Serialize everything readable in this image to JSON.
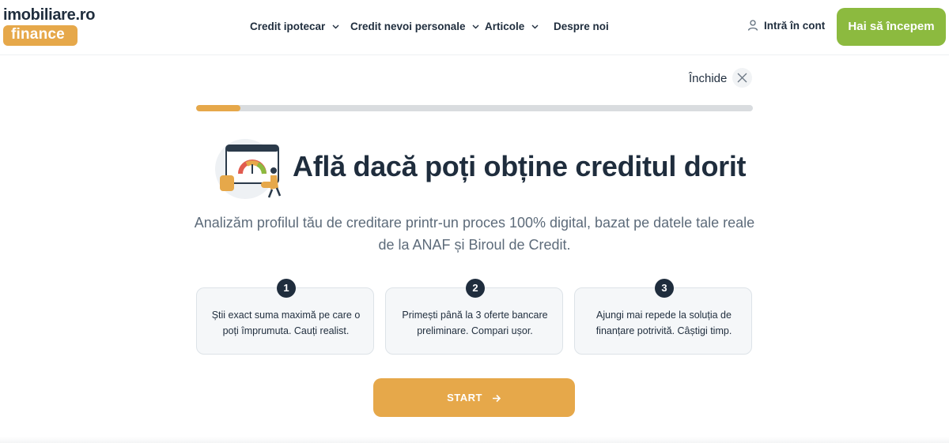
{
  "brand": {
    "logo_prefix": "im",
    "logo_rest": "obiliare.ro",
    "logo_badge": "finance",
    "accent": "#e6a84a",
    "cta_green": "#8cba3f",
    "dark": "#1f2d3d"
  },
  "nav": {
    "items": [
      {
        "label": "Credit ipotecar",
        "icon": "chevron-down-icon"
      },
      {
        "label": "Credit nevoi personale",
        "icon": "chevron-down-icon"
      },
      {
        "label": "Articole",
        "icon": "chevron-down-icon"
      },
      {
        "label": "Despre noi"
      }
    ],
    "login_label": "Intră în cont",
    "login_icon": "user-icon",
    "cta_label": "Hai să începem"
  },
  "wizard": {
    "close_label": "Închide",
    "close_icon": "close-icon",
    "progress_fraction": 0.08
  },
  "hero": {
    "illustration": "credit-score-gauge-illustration",
    "title": "Află dacă poți obține creditul dorit",
    "subtitle": "Analizăm profilul tău de creditare printr-un proces 100% digital, bazat pe datele tale reale de la ANAF și Biroul de Credit."
  },
  "steps": [
    {
      "number": "1",
      "text": "Știi exact suma maximă pe care o poți împrumuta. Cauți realist."
    },
    {
      "number": "2",
      "text": "Primești până la 3 oferte bancare preliminare. Compari ușor."
    },
    {
      "number": "3",
      "text": "Ajungi mai repede la soluția de finanțare potrivită. Câștigi timp."
    }
  ],
  "start": {
    "label": "START",
    "icon": "arrow-right-icon"
  }
}
